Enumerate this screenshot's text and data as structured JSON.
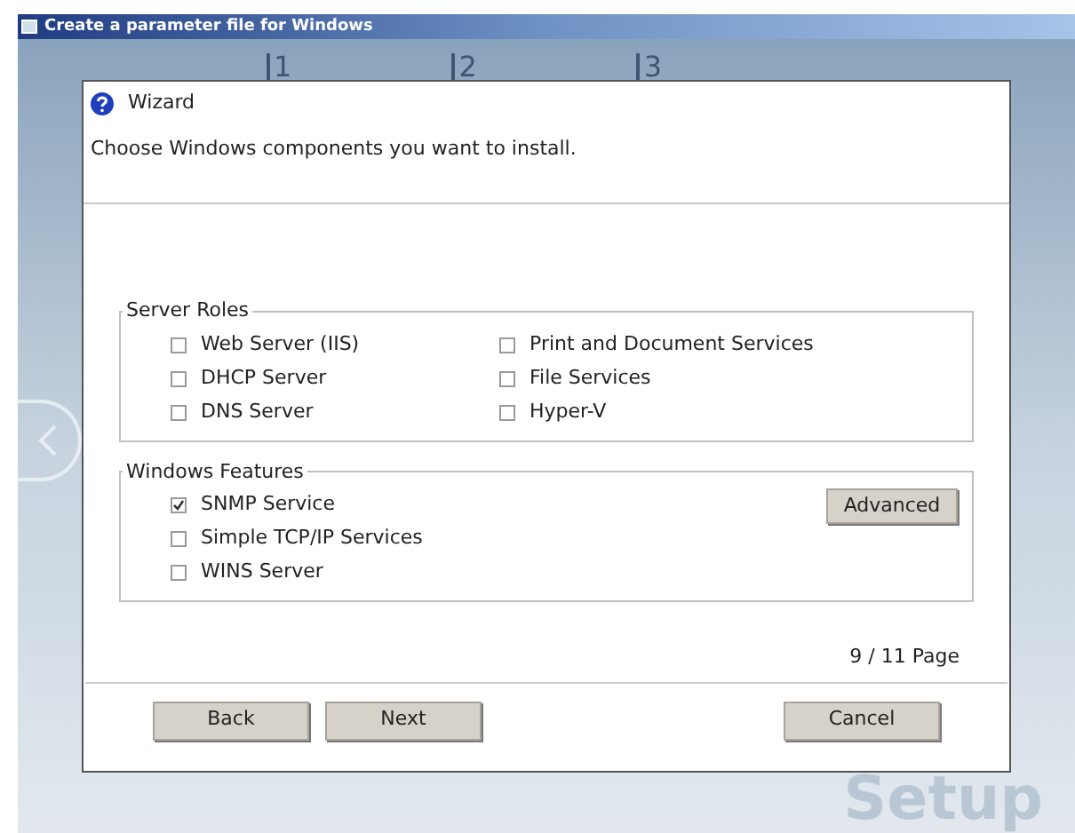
{
  "window": {
    "title": "Create a parameter file for Windows"
  },
  "steps": [
    "1",
    "2",
    "3"
  ],
  "watermark_text": "Setup",
  "dialog": {
    "title": "Wizard",
    "instruction": "Choose Windows components you want to install.",
    "groups": [
      {
        "title": "Server Roles",
        "columns": [
          [
            {
              "label": "Web Server (IIS)",
              "checked": false
            },
            {
              "label": "DHCP Server",
              "checked": false
            },
            {
              "label": "DNS Server",
              "checked": false
            }
          ],
          [
            {
              "label": "Print and Document Services",
              "checked": false
            },
            {
              "label": "File Services",
              "checked": false
            },
            {
              "label": "Hyper-V",
              "checked": false
            }
          ]
        ]
      },
      {
        "title": "Windows Features",
        "button": "Advanced",
        "columns": [
          [
            {
              "label": "SNMP Service",
              "checked": true
            },
            {
              "label": "Simple TCP/IP Services",
              "checked": false
            },
            {
              "label": "WINS Server",
              "checked": false
            }
          ]
        ]
      }
    ],
    "page_indicator": "9 / 11 Page",
    "buttons": {
      "back": "Back",
      "next": "Next",
      "cancel": "Cancel"
    }
  }
}
